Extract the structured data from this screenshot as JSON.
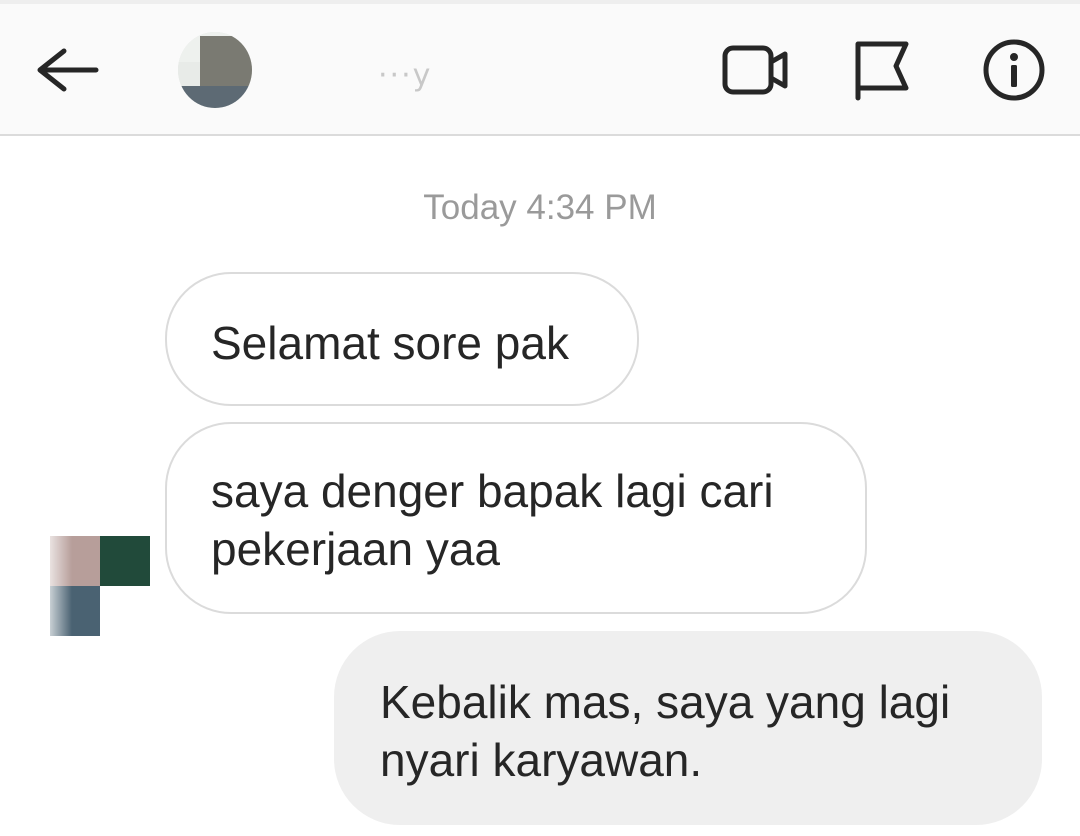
{
  "header": {
    "username": "···y",
    "back_icon": "arrow-left-icon",
    "video_icon": "video-camera-icon",
    "flag_icon": "flag-icon",
    "info_icon": "info-circle-icon"
  },
  "conversation": {
    "timestamp": "Today 4:34 PM",
    "messages": [
      {
        "direction": "incoming",
        "text": "Selamat sore pak"
      },
      {
        "direction": "incoming",
        "text": "saya denger bapak lagi cari\npekerjaan yaa"
      },
      {
        "direction": "outgoing",
        "text": "Kebalik mas, saya yang lagi\nnyari karyawan."
      }
    ]
  },
  "colors": {
    "header_bg": "#fafafa",
    "incoming_bubble_border": "#dbdbdb",
    "outgoing_bubble_bg": "#efefef",
    "text": "#262626",
    "timestamp": "#9a9a9a"
  }
}
